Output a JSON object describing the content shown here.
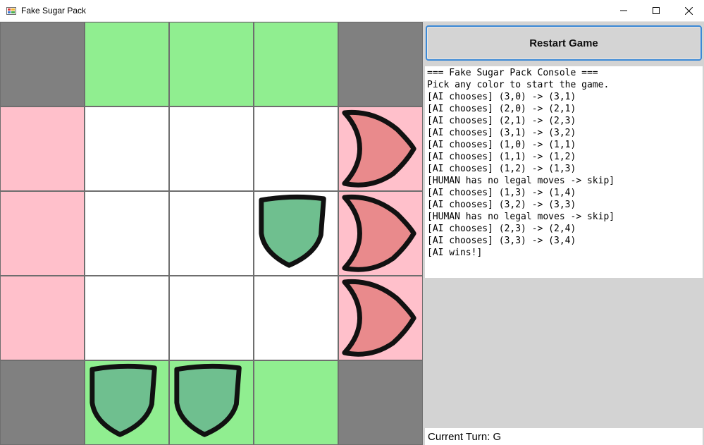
{
  "window": {
    "title": "Fake Sugar Pack"
  },
  "colors": {
    "corner": "#808080",
    "green_edge": "#90ee90",
    "pink_edge": "#ffc0cb",
    "inner": "#ffffff",
    "green_piece": "#6fbf8f",
    "red_piece": "#e98a8c",
    "piece_outline": "#111111"
  },
  "board": {
    "size": 5,
    "cells": [
      [
        "corner",
        "green",
        "green",
        "green",
        "corner"
      ],
      [
        "pink",
        "white",
        "white",
        "white",
        "pink"
      ],
      [
        "pink",
        "white",
        "white",
        "white",
        "pink"
      ],
      [
        "pink",
        "white",
        "white",
        "white",
        "pink"
      ],
      [
        "corner",
        "green",
        "green",
        "green",
        "corner"
      ]
    ],
    "pieces": [
      {
        "row": 1,
        "col": 4,
        "type": "red-arrow"
      },
      {
        "row": 2,
        "col": 3,
        "type": "green-shield"
      },
      {
        "row": 2,
        "col": 4,
        "type": "red-arrow"
      },
      {
        "row": 3,
        "col": 4,
        "type": "red-arrow"
      },
      {
        "row": 4,
        "col": 1,
        "type": "green-shield"
      },
      {
        "row": 4,
        "col": 2,
        "type": "green-shield"
      }
    ]
  },
  "controls": {
    "restart_label": "Restart Game"
  },
  "console": {
    "lines": [
      "=== Fake Sugar Pack Console ===",
      "Pick any color to start the game.",
      "[AI chooses] (3,0) -> (3,1)",
      "[AI chooses] (2,0) -> (2,1)",
      "[AI chooses] (2,1) -> (2,3)",
      "[AI chooses] (3,1) -> (3,2)",
      "[AI chooses] (1,0) -> (1,1)",
      "[AI chooses] (1,1) -> (1,2)",
      "[AI chooses] (1,2) -> (1,3)",
      "[HUMAN has no legal moves -> skip]",
      "[AI chooses] (1,3) -> (1,4)",
      "[AI chooses] (3,2) -> (3,3)",
      "[HUMAN has no legal moves -> skip]",
      "[AI chooses] (2,3) -> (2,4)",
      "[AI chooses] (3,3) -> (3,4)",
      "[AI wins!]"
    ]
  },
  "status": {
    "current_turn": "Current Turn: G"
  }
}
